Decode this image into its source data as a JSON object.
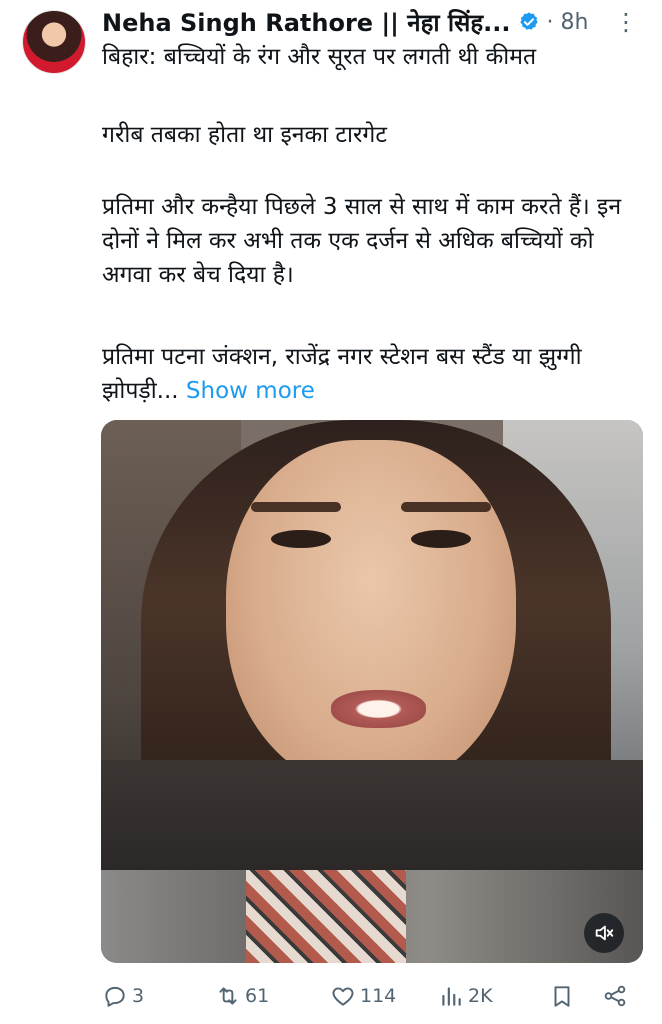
{
  "tweet": {
    "author": {
      "name": "Neha Singh Rathore || नेहा सिंह..."
    },
    "time": "· 8h",
    "more": "⋮",
    "paragraphs": [
      "बिहार: बच्चियों के रंग और सूरत पर लगती थी कीमत",
      "गरीब तबका होता था इनका टारगेट",
      "प्रतिमा और कन्हैया पिछले 3 साल से साथ में काम करते हैं। इन दोनों ने मिल कर अभी तक एक दर्जन से अधिक बच्चियों को अगवा कर बेच दिया है।",
      "प्रतिमा पटना जंक्शन, राजेंद्र नगर स्टेशन बस स्टैंड या झुग्गी झोपड़ी... "
    ],
    "show_more": "Show more"
  },
  "actions": {
    "replies": "3",
    "retweets": "61",
    "likes": "114",
    "views": "2K"
  },
  "colors": {
    "accent": "#1d9bf0",
    "text": "#0f1419",
    "muted": "#536471",
    "verified_badge": "#1d9bf0"
  },
  "icons": [
    "more-icon",
    "verified-icon",
    "reply-icon",
    "retweet-icon",
    "like-icon",
    "views-icon",
    "bookmark-icon",
    "share-icon",
    "mute-icon"
  ]
}
